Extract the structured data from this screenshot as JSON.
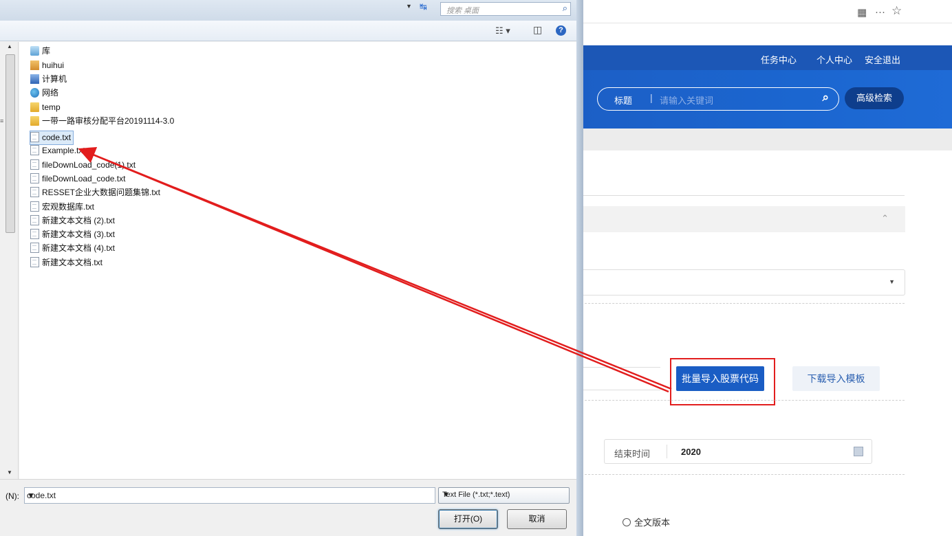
{
  "browser": {
    "qr_icon": "qr-code-icon",
    "more_icon": "more-icon",
    "star_icon": "star-icon"
  },
  "site": {
    "nav_links": [
      "任务中心",
      "个人中心",
      "安全退出"
    ],
    "search": {
      "field_label": "标题",
      "separator": "|",
      "placeholder": "请输入关键词",
      "icon": "search-icon"
    },
    "advanced_search": "高级检索",
    "import_button": "批量导入股票代码",
    "template_button": "下载导入模板",
    "end_time_label": "结束时间",
    "end_time_value": "2020",
    "fulltext_radio": "全文版本",
    "paren_fragment": ")"
  },
  "dialog": {
    "search_placeholder": "搜索 桌面",
    "view_icon": "view-options-icon",
    "preview_icon": "preview-pane-icon",
    "help_icon": "?",
    "items": [
      {
        "label": "库",
        "type": "lib"
      },
      {
        "label": "huihui",
        "type": "user"
      },
      {
        "label": "计算机",
        "type": "pc"
      },
      {
        "label": "网络",
        "type": "net"
      },
      {
        "label": "temp",
        "type": "folder"
      },
      {
        "label": "一带一路审核分配平台20191114-3.0",
        "type": "folder"
      },
      {
        "label": "code.txt",
        "type": "txt",
        "selected": true
      },
      {
        "label": "Example.txt",
        "type": "txt"
      },
      {
        "label": "fileDownLoad_code(1).txt",
        "type": "txt"
      },
      {
        "label": "fileDownLoad_code.txt",
        "type": "txt"
      },
      {
        "label": "RESSET企业大数据问题集锦.txt",
        "type": "txt"
      },
      {
        "label": "宏观数据库.txt",
        "type": "txt"
      },
      {
        "label": "新建文本文档 (2).txt",
        "type": "txt"
      },
      {
        "label": "新建文本文档 (3).txt",
        "type": "txt"
      },
      {
        "label": "新建文本文档 (4).txt",
        "type": "txt"
      },
      {
        "label": "新建文本文档.txt",
        "type": "txt"
      }
    ],
    "filename_label": "(N):",
    "filename_value": "code.txt",
    "filetype_value": "Text File (*.txt;*.text)",
    "open_button": "打开(O)",
    "cancel_button": "取消"
  },
  "annotation": {
    "color": "#e21d1d"
  }
}
